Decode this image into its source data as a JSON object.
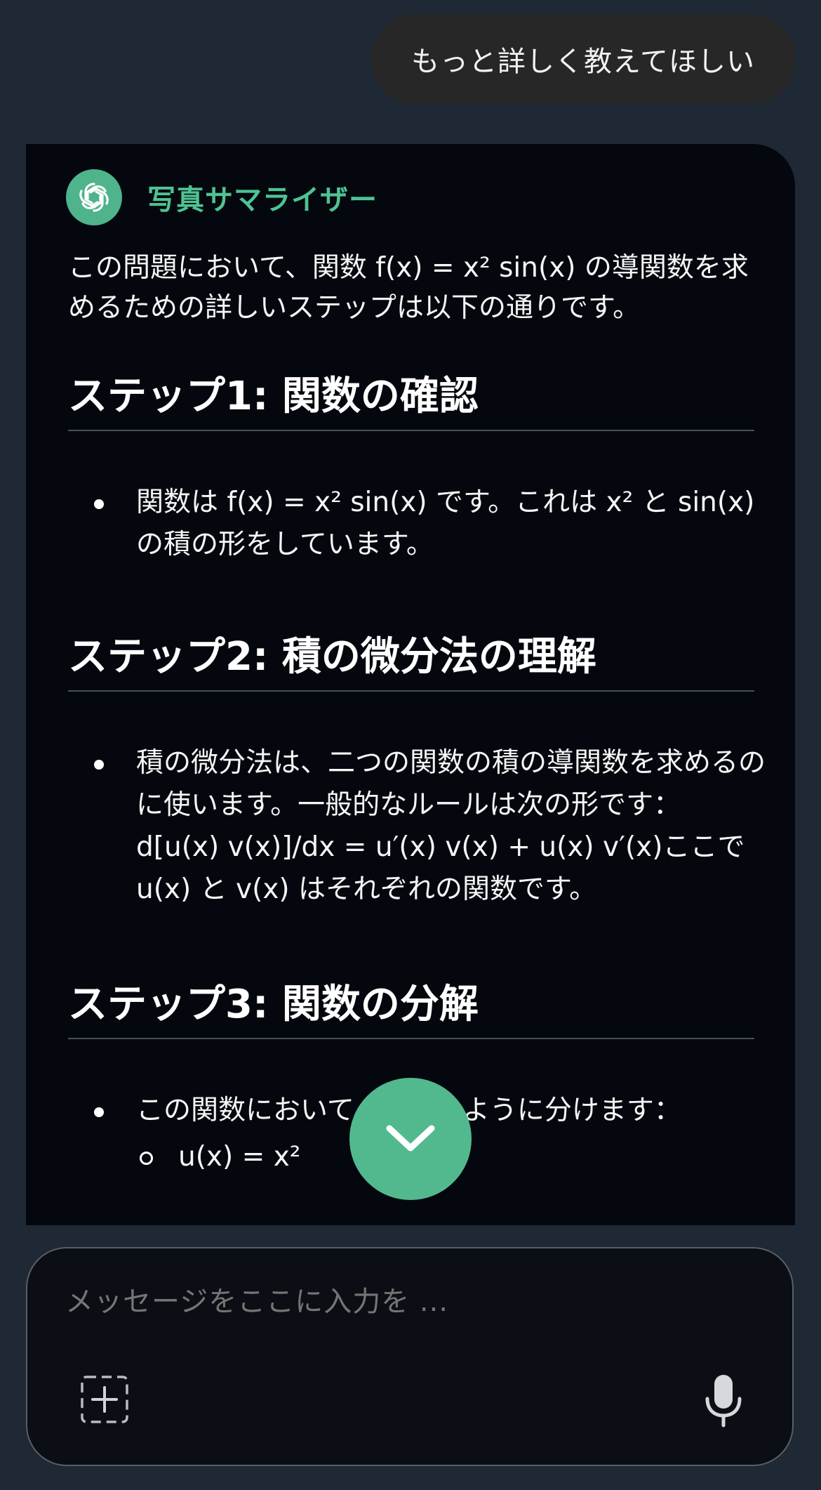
{
  "user_message": "もっと詳しく教えてほしい",
  "assistant": {
    "name": "写真サマライザー",
    "intro": "この問題において、関数 f(x) = x² sin(x) の導関数を求めるための詳しいステップは以下の通りです。",
    "steps": [
      {
        "heading": "ステップ1: 関数の確認",
        "body": "関数は f(x) = x² sin(x) です。これは x² と sin(x) の積の形をしています。"
      },
      {
        "heading": "ステップ2: 積の微分法の理解",
        "body": "積の微分法は、二つの関数の積の導関数を求めるのに使います。一般的なルールは次の形です：  d[u(x) v(x)]/dx = u′(x) v(x) + u(x) v′(x)ここで u(x) と v(x) はそれぞれの関数です。"
      },
      {
        "heading": "ステップ3: 関数の分解",
        "body": "この関数において、以下のように分けます：",
        "sub_item": "u(x) = x²"
      }
    ]
  },
  "composer": {
    "placeholder": "メッセージをここに入力を ..."
  },
  "icons": {
    "avatar": "openai-logo-icon",
    "scroll": "chevron-down-icon",
    "attach": "add-attachment-icon",
    "mic": "microphone-icon"
  },
  "colors": {
    "background": "#1f2835",
    "card": "#04080e",
    "accent": "#52b98f",
    "bot_name": "#4fc393",
    "user_bubble": "#272727"
  }
}
